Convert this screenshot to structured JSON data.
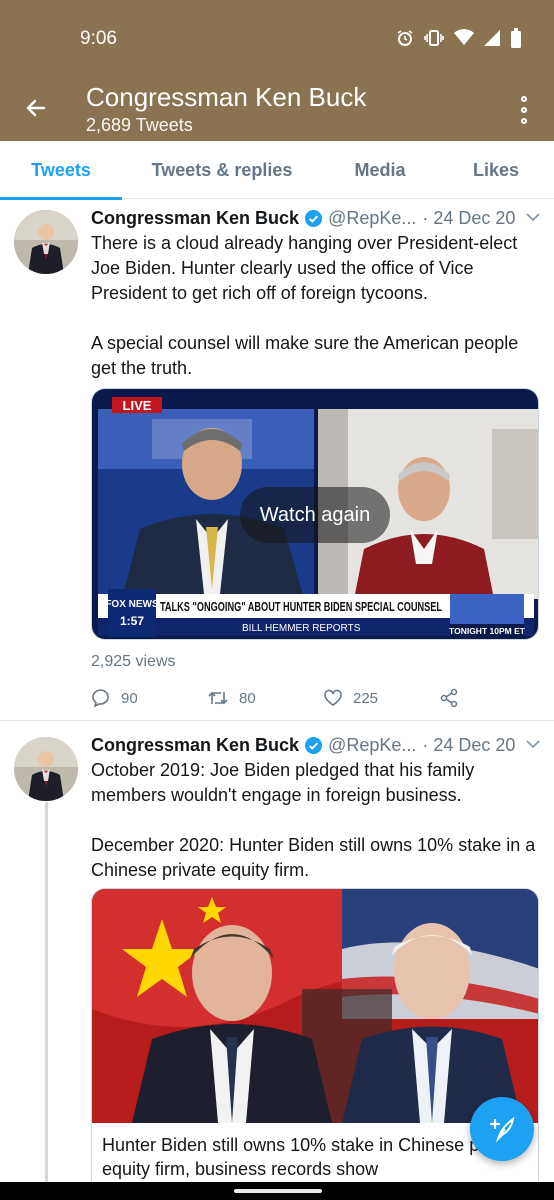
{
  "status": {
    "time": "9:06"
  },
  "header": {
    "title": "Congressman Ken Buck",
    "subtitle": "2,689 Tweets"
  },
  "tabs": [
    {
      "label": "Tweets",
      "active": true
    },
    {
      "label": "Tweets & replies",
      "active": false
    },
    {
      "label": "Media",
      "active": false
    },
    {
      "label": "Likes",
      "active": false
    }
  ],
  "tweets": [
    {
      "name": "Congressman Ken Buck",
      "handle": "@RepKe...",
      "separator": "·",
      "date": "24 Dec 20",
      "text": "There is a cloud already hanging over President-elect Joe Biden. Hunter clearly used the office of Vice President to get rich off of foreign tycoons.\n\nA special counsel will make sure the American people get the truth.",
      "media": {
        "overlay": "Watch again",
        "live_tag": "LIVE",
        "chyron": "TALKS \"ONGOING\" ABOUT HUNTER BIDEN SPECIAL COUNSEL",
        "subchyron": "BILL HEMMER REPORTS",
        "network": "FOX NEWS",
        "clock": "1:57",
        "promo": "TONIGHT 10PM ET"
      },
      "views": "2,925 views",
      "replies": "90",
      "retweets": "80",
      "likes": "225"
    },
    {
      "name": "Congressman Ken Buck",
      "handle": "@RepKe...",
      "separator": "·",
      "date": "24 Dec 20",
      "text": "October 2019: Joe Biden pledged that his family members wouldn't engage in foreign business.\n\nDecember 2020: Hunter Biden still owns 10% stake in a Chinese private equity firm.",
      "card": {
        "title": "Hunter Biden still owns 10% stake in Chinese private equity firm, business records show"
      }
    }
  ],
  "colors": {
    "header_bg": "#8a7350",
    "accent": "#1da1f2",
    "muted": "#657786"
  }
}
